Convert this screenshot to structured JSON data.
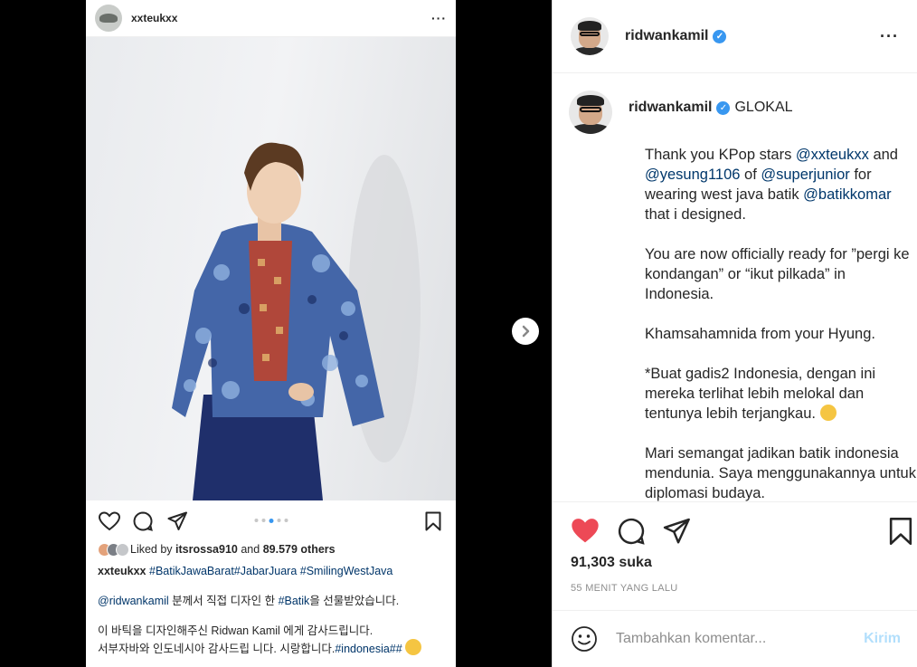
{
  "embedded_post": {
    "username": "xxteukxx",
    "more_icon": "···",
    "liked_by_prefix": "Liked by",
    "liked_by_user": "itsrossa910",
    "liked_by_suffix": "and",
    "liked_by_others": "89.579 others",
    "caption_user": "xxteukxx",
    "caption_tags": "#BatikJawaBarat#JabarJuara #SmilingWestJava",
    "line1_mention": "@ridwankamil",
    "line1_text_a": " 분께서 직접 디자인 한 ",
    "line1_tag": "#Batik",
    "line1_text_b": "을 선물받았습니다.",
    "line2": "이 바틱을 디자인해주신 Ridwan Kamil 에게 감사드립니다.",
    "line3_text": "서부자바와 인도네시아 감사드립 니다. 시랑합니다.",
    "line3_tag": "#indonesia##"
  },
  "post": {
    "username": "ridwankamil",
    "more_icon": "···",
    "caption_title": "GLOKAL",
    "para1": {
      "a": "Thank you KPop stars ",
      "m1": "@xxteukxx",
      "b": " and ",
      "m2": "@yesung1106",
      "c": " of ",
      "m3": "@superjunior",
      "d": " for wearing west java batik ",
      "m4": "@batikkomar",
      "e": " that i designed."
    },
    "para2": "You are now officially ready for ”pergi ke kondangan” or “ikut pilkada” in Indonesia.",
    "para3": "Khamsahamnida from your Hyung.",
    "para4": "*Buat gadis2 Indonesia, dengan ini mereka terlihat lebih melokal dan tentunya lebih terjangkau.",
    "para5": "Mari semangat jadikan batik indonesia mendunia. Saya menggunakannya untuk diplomasi budaya.",
    "likes": "91,303 suka",
    "time": "55 MENIT YANG LALU",
    "comment_placeholder": "Tambahkan komentar...",
    "post_button": "Kirim"
  },
  "colors": {
    "like_red": "#ed4956",
    "link_blue": "#00376b",
    "post_disabled": "#b2dffc",
    "verified_blue": "#3897f0"
  },
  "icons": [
    "heart-icon",
    "comment-icon",
    "share-icon",
    "bookmark-icon",
    "emoji-icon",
    "next-arrow-icon",
    "verified-icon",
    "more-icon"
  ]
}
